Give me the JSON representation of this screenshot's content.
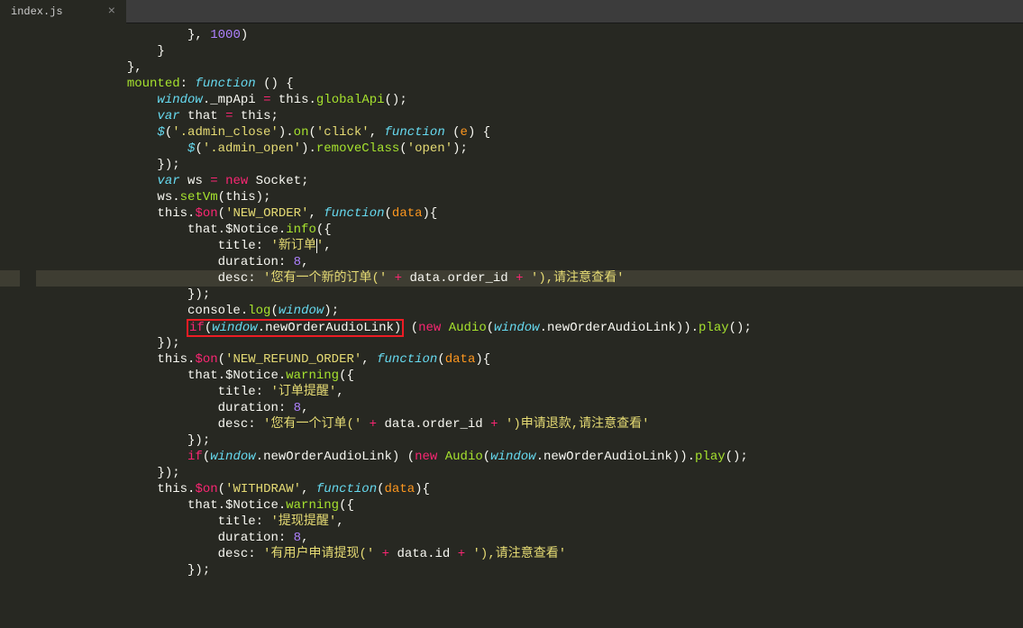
{
  "tab": {
    "filename": "index.js",
    "close": "×"
  },
  "cursor_line_index": 15,
  "lines": [
    {
      "tokens": [
        {
          "t": "                    }, ",
          "c": "k-white"
        },
        {
          "t": "1000",
          "c": "k-purple"
        },
        {
          "t": ")",
          "c": "k-white"
        }
      ]
    },
    {
      "tokens": [
        {
          "t": "                }",
          "c": "k-white"
        }
      ]
    },
    {
      "tokens": [
        {
          "t": "            },",
          "c": "k-white"
        }
      ]
    },
    {
      "tokens": [
        {
          "t": "            ",
          "c": ""
        },
        {
          "t": "mounted",
          "c": "k-green"
        },
        {
          "t": ":",
          "c": "k-white"
        },
        {
          "t": " ",
          "c": ""
        },
        {
          "t": "function",
          "c": "k-blue"
        },
        {
          "t": " () {",
          "c": "k-white"
        }
      ]
    },
    {
      "tokens": [
        {
          "t": "                ",
          "c": ""
        },
        {
          "t": "window",
          "c": "k-blue"
        },
        {
          "t": ".",
          "c": "k-white"
        },
        {
          "t": "_mpApi",
          "c": "k-white"
        },
        {
          "t": " ",
          "c": ""
        },
        {
          "t": "=",
          "c": "k-pink"
        },
        {
          "t": " ",
          "c": ""
        },
        {
          "t": "this",
          "c": "k-white"
        },
        {
          "t": ".",
          "c": "k-white"
        },
        {
          "t": "globalApi",
          "c": "k-green"
        },
        {
          "t": "();",
          "c": "k-white"
        }
      ]
    },
    {
      "tokens": [
        {
          "t": "                ",
          "c": ""
        },
        {
          "t": "var",
          "c": "k-blue"
        },
        {
          "t": " that ",
          "c": "k-white"
        },
        {
          "t": "=",
          "c": "k-pink"
        },
        {
          "t": " ",
          "c": ""
        },
        {
          "t": "this",
          "c": "k-white"
        },
        {
          "t": ";",
          "c": "k-white"
        }
      ]
    },
    {
      "tokens": [
        {
          "t": "                ",
          "c": ""
        },
        {
          "t": "$",
          "c": "k-blue"
        },
        {
          "t": "(",
          "c": "k-white"
        },
        {
          "t": "'.admin_close'",
          "c": "k-yellow"
        },
        {
          "t": ").",
          "c": "k-white"
        },
        {
          "t": "on",
          "c": "k-green"
        },
        {
          "t": "(",
          "c": "k-white"
        },
        {
          "t": "'click'",
          "c": "k-yellow"
        },
        {
          "t": ", ",
          "c": "k-white"
        },
        {
          "t": "function",
          "c": "k-blue"
        },
        {
          "t": " (",
          "c": "k-white"
        },
        {
          "t": "e",
          "c": "k-orange"
        },
        {
          "t": ") {",
          "c": "k-white"
        }
      ]
    },
    {
      "tokens": [
        {
          "t": "                    ",
          "c": ""
        },
        {
          "t": "$",
          "c": "k-blue"
        },
        {
          "t": "(",
          "c": "k-white"
        },
        {
          "t": "'.admin_open'",
          "c": "k-yellow"
        },
        {
          "t": ").",
          "c": "k-white"
        },
        {
          "t": "removeClass",
          "c": "k-green"
        },
        {
          "t": "(",
          "c": "k-white"
        },
        {
          "t": "'open'",
          "c": "k-yellow"
        },
        {
          "t": ");",
          "c": "k-white"
        }
      ]
    },
    {
      "tokens": [
        {
          "t": "                });",
          "c": "k-white"
        }
      ]
    },
    {
      "tokens": [
        {
          "t": "                ",
          "c": ""
        },
        {
          "t": "var",
          "c": "k-blue"
        },
        {
          "t": " ws ",
          "c": "k-white"
        },
        {
          "t": "=",
          "c": "k-pink"
        },
        {
          "t": " ",
          "c": ""
        },
        {
          "t": "new",
          "c": "k-pink"
        },
        {
          "t": " Socket;",
          "c": "k-white"
        }
      ]
    },
    {
      "tokens": [
        {
          "t": "                ws.",
          "c": "k-white"
        },
        {
          "t": "setVm",
          "c": "k-green"
        },
        {
          "t": "(",
          "c": "k-white"
        },
        {
          "t": "this",
          "c": "k-white"
        },
        {
          "t": ");",
          "c": "k-white"
        }
      ]
    },
    {
      "tokens": [
        {
          "t": "                ",
          "c": ""
        },
        {
          "t": "this",
          "c": "k-white"
        },
        {
          "t": ".",
          "c": "k-white"
        },
        {
          "t": "$on",
          "c": "k-pink"
        },
        {
          "t": "(",
          "c": "k-white"
        },
        {
          "t": "'NEW_ORDER'",
          "c": "k-yellow"
        },
        {
          "t": ", ",
          "c": "k-white"
        },
        {
          "t": "function",
          "c": "k-blue"
        },
        {
          "t": "(",
          "c": "k-white"
        },
        {
          "t": "data",
          "c": "k-orange"
        },
        {
          "t": "){",
          "c": "k-white"
        }
      ]
    },
    {
      "tokens": [
        {
          "t": "                    that.$Notice.",
          "c": "k-white"
        },
        {
          "t": "info",
          "c": "k-green"
        },
        {
          "t": "({",
          "c": "k-white"
        }
      ]
    },
    {
      "tokens": [
        {
          "t": "                        title: ",
          "c": "k-white"
        },
        {
          "t": "'新订单",
          "c": "k-yellow"
        },
        {
          "t": "",
          "c": "cursor-mark"
        },
        {
          "t": "'",
          "c": "k-yellow"
        },
        {
          "t": ",",
          "c": "k-white"
        }
      ]
    },
    {
      "tokens": [
        {
          "t": "                        duration: ",
          "c": "k-white"
        },
        {
          "t": "8",
          "c": "k-purple"
        },
        {
          "t": ",",
          "c": "k-white"
        }
      ]
    },
    {
      "highlighted": true,
      "tokens": [
        {
          "t": "                        desc: ",
          "c": "k-white"
        },
        {
          "t": "'您有一个新的订单('",
          "c": "k-yellow"
        },
        {
          "t": " ",
          "c": ""
        },
        {
          "t": "+",
          "c": "k-pink"
        },
        {
          "t": " data.order_id ",
          "c": "k-white"
        },
        {
          "t": "+",
          "c": "k-pink"
        },
        {
          "t": " ",
          "c": ""
        },
        {
          "t": "'),请注意查看'",
          "c": "k-yellow"
        }
      ]
    },
    {
      "tokens": [
        {
          "t": "                    });",
          "c": "k-white"
        }
      ]
    },
    {
      "tokens": [
        {
          "t": "                    console.",
          "c": "k-white"
        },
        {
          "t": "log",
          "c": "k-green"
        },
        {
          "t": "(",
          "c": "k-white"
        },
        {
          "t": "window",
          "c": "k-blue"
        },
        {
          "t": ");",
          "c": "k-white"
        }
      ]
    },
    {
      "tokens": [
        {
          "t": "                    ",
          "c": ""
        },
        {
          "t": "if(window.newOrderAudioLink)",
          "redbox": true,
          "parts": [
            {
              "t": "if",
              "c": "k-pink"
            },
            {
              "t": "(",
              "c": "k-white"
            },
            {
              "t": "window",
              "c": "k-blue"
            },
            {
              "t": ".newOrderAudioLink)",
              "c": "k-white"
            }
          ]
        },
        {
          "t": " (",
          "c": "k-white"
        },
        {
          "t": "new",
          "c": "k-pink"
        },
        {
          "t": " ",
          "c": ""
        },
        {
          "t": "Audio",
          "c": "k-green"
        },
        {
          "t": "(",
          "c": "k-white"
        },
        {
          "t": "window",
          "c": "k-blue"
        },
        {
          "t": ".newOrderAudioLink)).",
          "c": "k-white"
        },
        {
          "t": "play",
          "c": "k-green"
        },
        {
          "t": "();",
          "c": "k-white"
        }
      ]
    },
    {
      "tokens": [
        {
          "t": "                });",
          "c": "k-white"
        }
      ]
    },
    {
      "tokens": [
        {
          "t": "                ",
          "c": ""
        },
        {
          "t": "this",
          "c": "k-white"
        },
        {
          "t": ".",
          "c": "k-white"
        },
        {
          "t": "$on",
          "c": "k-pink"
        },
        {
          "t": "(",
          "c": "k-white"
        },
        {
          "t": "'NEW_REFUND_ORDER'",
          "c": "k-yellow"
        },
        {
          "t": ", ",
          "c": "k-white"
        },
        {
          "t": "function",
          "c": "k-blue"
        },
        {
          "t": "(",
          "c": "k-white"
        },
        {
          "t": "data",
          "c": "k-orange"
        },
        {
          "t": "){",
          "c": "k-white"
        }
      ]
    },
    {
      "tokens": [
        {
          "t": "                    that.$Notice.",
          "c": "k-white"
        },
        {
          "t": "warning",
          "c": "k-green"
        },
        {
          "t": "({",
          "c": "k-white"
        }
      ]
    },
    {
      "tokens": [
        {
          "t": "                        title: ",
          "c": "k-white"
        },
        {
          "t": "'订单提醒'",
          "c": "k-yellow"
        },
        {
          "t": ",",
          "c": "k-white"
        }
      ]
    },
    {
      "tokens": [
        {
          "t": "                        duration: ",
          "c": "k-white"
        },
        {
          "t": "8",
          "c": "k-purple"
        },
        {
          "t": ",",
          "c": "k-white"
        }
      ]
    },
    {
      "tokens": [
        {
          "t": "                        desc: ",
          "c": "k-white"
        },
        {
          "t": "'您有一个订单('",
          "c": "k-yellow"
        },
        {
          "t": " ",
          "c": ""
        },
        {
          "t": "+",
          "c": "k-pink"
        },
        {
          "t": " data.order_id ",
          "c": "k-white"
        },
        {
          "t": "+",
          "c": "k-pink"
        },
        {
          "t": " ",
          "c": ""
        },
        {
          "t": "')申请退款,请注意查看'",
          "c": "k-yellow"
        }
      ]
    },
    {
      "tokens": [
        {
          "t": "                    });",
          "c": "k-white"
        }
      ]
    },
    {
      "tokens": [
        {
          "t": "                    ",
          "c": ""
        },
        {
          "t": "if",
          "c": "k-pink"
        },
        {
          "t": "(",
          "c": "k-white"
        },
        {
          "t": "window",
          "c": "k-blue"
        },
        {
          "t": ".newOrderAudioLink) (",
          "c": "k-white"
        },
        {
          "t": "new",
          "c": "k-pink"
        },
        {
          "t": " ",
          "c": ""
        },
        {
          "t": "Audio",
          "c": "k-green"
        },
        {
          "t": "(",
          "c": "k-white"
        },
        {
          "t": "window",
          "c": "k-blue"
        },
        {
          "t": ".newOrderAudioLink)).",
          "c": "k-white"
        },
        {
          "t": "play",
          "c": "k-green"
        },
        {
          "t": "();",
          "c": "k-white"
        }
      ]
    },
    {
      "tokens": [
        {
          "t": "                });",
          "c": "k-white"
        }
      ]
    },
    {
      "tokens": [
        {
          "t": "                ",
          "c": ""
        },
        {
          "t": "this",
          "c": "k-white"
        },
        {
          "t": ".",
          "c": "k-white"
        },
        {
          "t": "$on",
          "c": "k-pink"
        },
        {
          "t": "(",
          "c": "k-white"
        },
        {
          "t": "'WITHDRAW'",
          "c": "k-yellow"
        },
        {
          "t": ", ",
          "c": "k-white"
        },
        {
          "t": "function",
          "c": "k-blue"
        },
        {
          "t": "(",
          "c": "k-white"
        },
        {
          "t": "data",
          "c": "k-orange"
        },
        {
          "t": "){",
          "c": "k-white"
        }
      ]
    },
    {
      "tokens": [
        {
          "t": "                    that.$Notice.",
          "c": "k-white"
        },
        {
          "t": "warning",
          "c": "k-green"
        },
        {
          "t": "({",
          "c": "k-white"
        }
      ]
    },
    {
      "tokens": [
        {
          "t": "                        title: ",
          "c": "k-white"
        },
        {
          "t": "'提现提醒'",
          "c": "k-yellow"
        },
        {
          "t": ",",
          "c": "k-white"
        }
      ]
    },
    {
      "tokens": [
        {
          "t": "                        duration: ",
          "c": "k-white"
        },
        {
          "t": "8",
          "c": "k-purple"
        },
        {
          "t": ",",
          "c": "k-white"
        }
      ]
    },
    {
      "tokens": [
        {
          "t": "                        desc: ",
          "c": "k-white"
        },
        {
          "t": "'有用户申请提现('",
          "c": "k-yellow"
        },
        {
          "t": " ",
          "c": ""
        },
        {
          "t": "+",
          "c": "k-pink"
        },
        {
          "t": " data.id ",
          "c": "k-white"
        },
        {
          "t": "+",
          "c": "k-pink"
        },
        {
          "t": " ",
          "c": ""
        },
        {
          "t": "'),请注意查看'",
          "c": "k-yellow"
        }
      ]
    },
    {
      "tokens": [
        {
          "t": "                    });",
          "c": "k-white"
        }
      ]
    }
  ]
}
